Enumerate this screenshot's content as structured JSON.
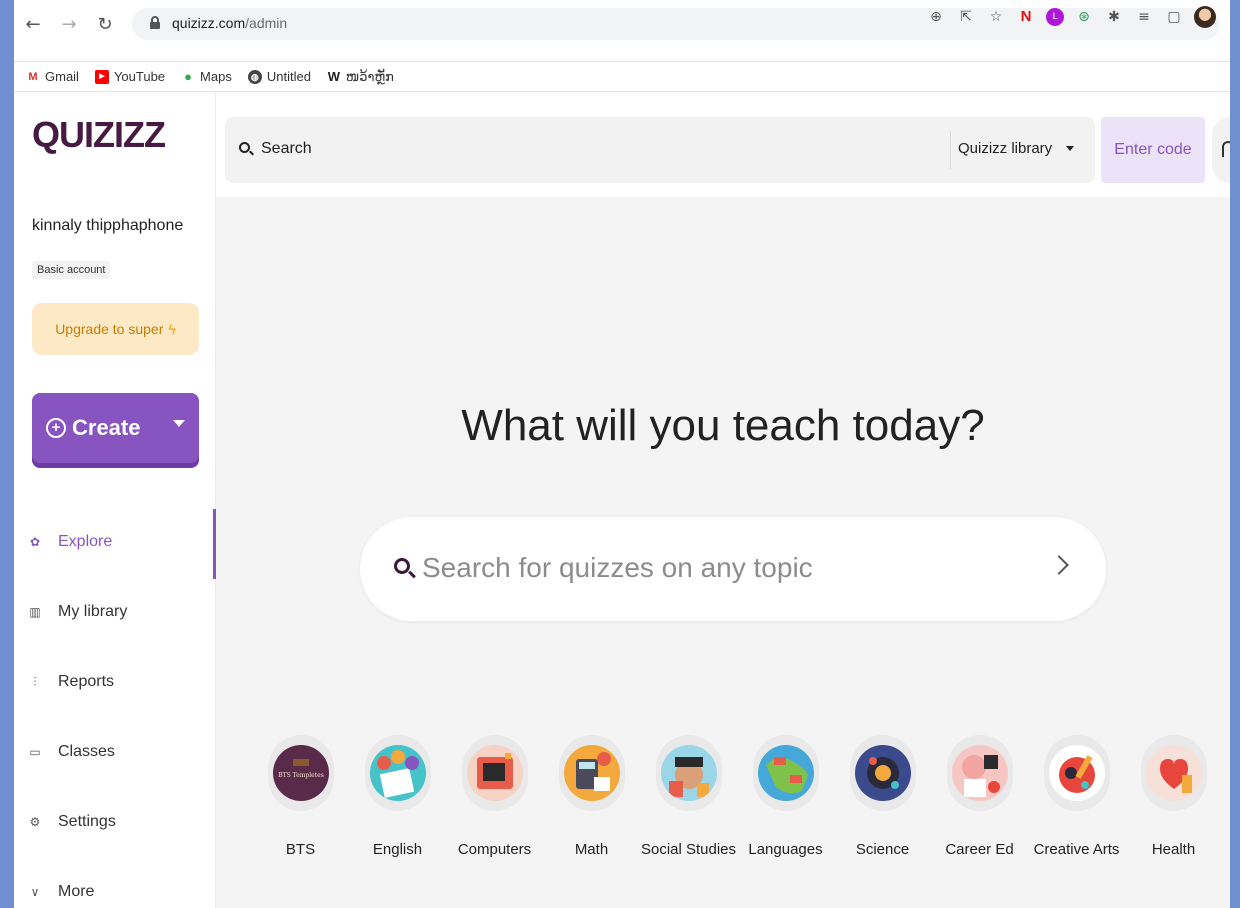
{
  "browser": {
    "url_host": "quizizz.com",
    "url_path": "/admin",
    "bookmarks": [
      {
        "label": "Gmail",
        "icon": "gmail-icon"
      },
      {
        "label": "YouTube",
        "icon": "youtube-icon"
      },
      {
        "label": "Maps",
        "icon": "maps-icon"
      },
      {
        "label": "Untitled",
        "icon": "globe-icon"
      },
      {
        "label": "ໜວ້າຫຼັກ",
        "icon": "w-icon"
      }
    ]
  },
  "sidebar": {
    "logo": "QUIZIZZ",
    "username": "kinnaly thipphaphone",
    "account_type": "Basic account",
    "upgrade_label": "Upgrade to super",
    "create_label": "Create",
    "nav": [
      {
        "label": "Explore",
        "icon": "explore-icon",
        "active": true
      },
      {
        "label": "My library",
        "icon": "library-icon",
        "active": false
      },
      {
        "label": "Reports",
        "icon": "reports-icon",
        "active": false
      },
      {
        "label": "Classes",
        "icon": "classes-icon",
        "active": false
      },
      {
        "label": "Settings",
        "icon": "settings-icon",
        "active": false
      },
      {
        "label": "More",
        "icon": "chevron-down-icon",
        "active": false
      }
    ]
  },
  "topbar": {
    "search_label": "Search",
    "library_select": "Quizizz library",
    "enter_code": "Enter code"
  },
  "main": {
    "title": "What will you teach today?",
    "search_placeholder": "Search for quizzes on any topic",
    "topics": [
      {
        "label": "BTS",
        "art_text": "BTS Templetes",
        "color": "#5a2a4a"
      },
      {
        "label": "English",
        "color": "#46c2c9"
      },
      {
        "label": "Computers",
        "color": "#e85d4a"
      },
      {
        "label": "Math",
        "color": "#f3a93b"
      },
      {
        "label": "Social Studies",
        "color": "#9bd6e8"
      },
      {
        "label": "Languages",
        "color": "#7fc24a"
      },
      {
        "label": "Science",
        "color": "#3b4a8c"
      },
      {
        "label": "Career Ed",
        "color": "#f2a4a0"
      },
      {
        "label": "Creative Arts",
        "color": "#e8453c"
      },
      {
        "label": "Health",
        "color": "#f2b9b0"
      }
    ]
  },
  "colors": {
    "accent": "#8854c0",
    "logo": "#461a42",
    "upgrade_bg": "#fde9c6",
    "enter_code_bg": "#ece3f8"
  }
}
